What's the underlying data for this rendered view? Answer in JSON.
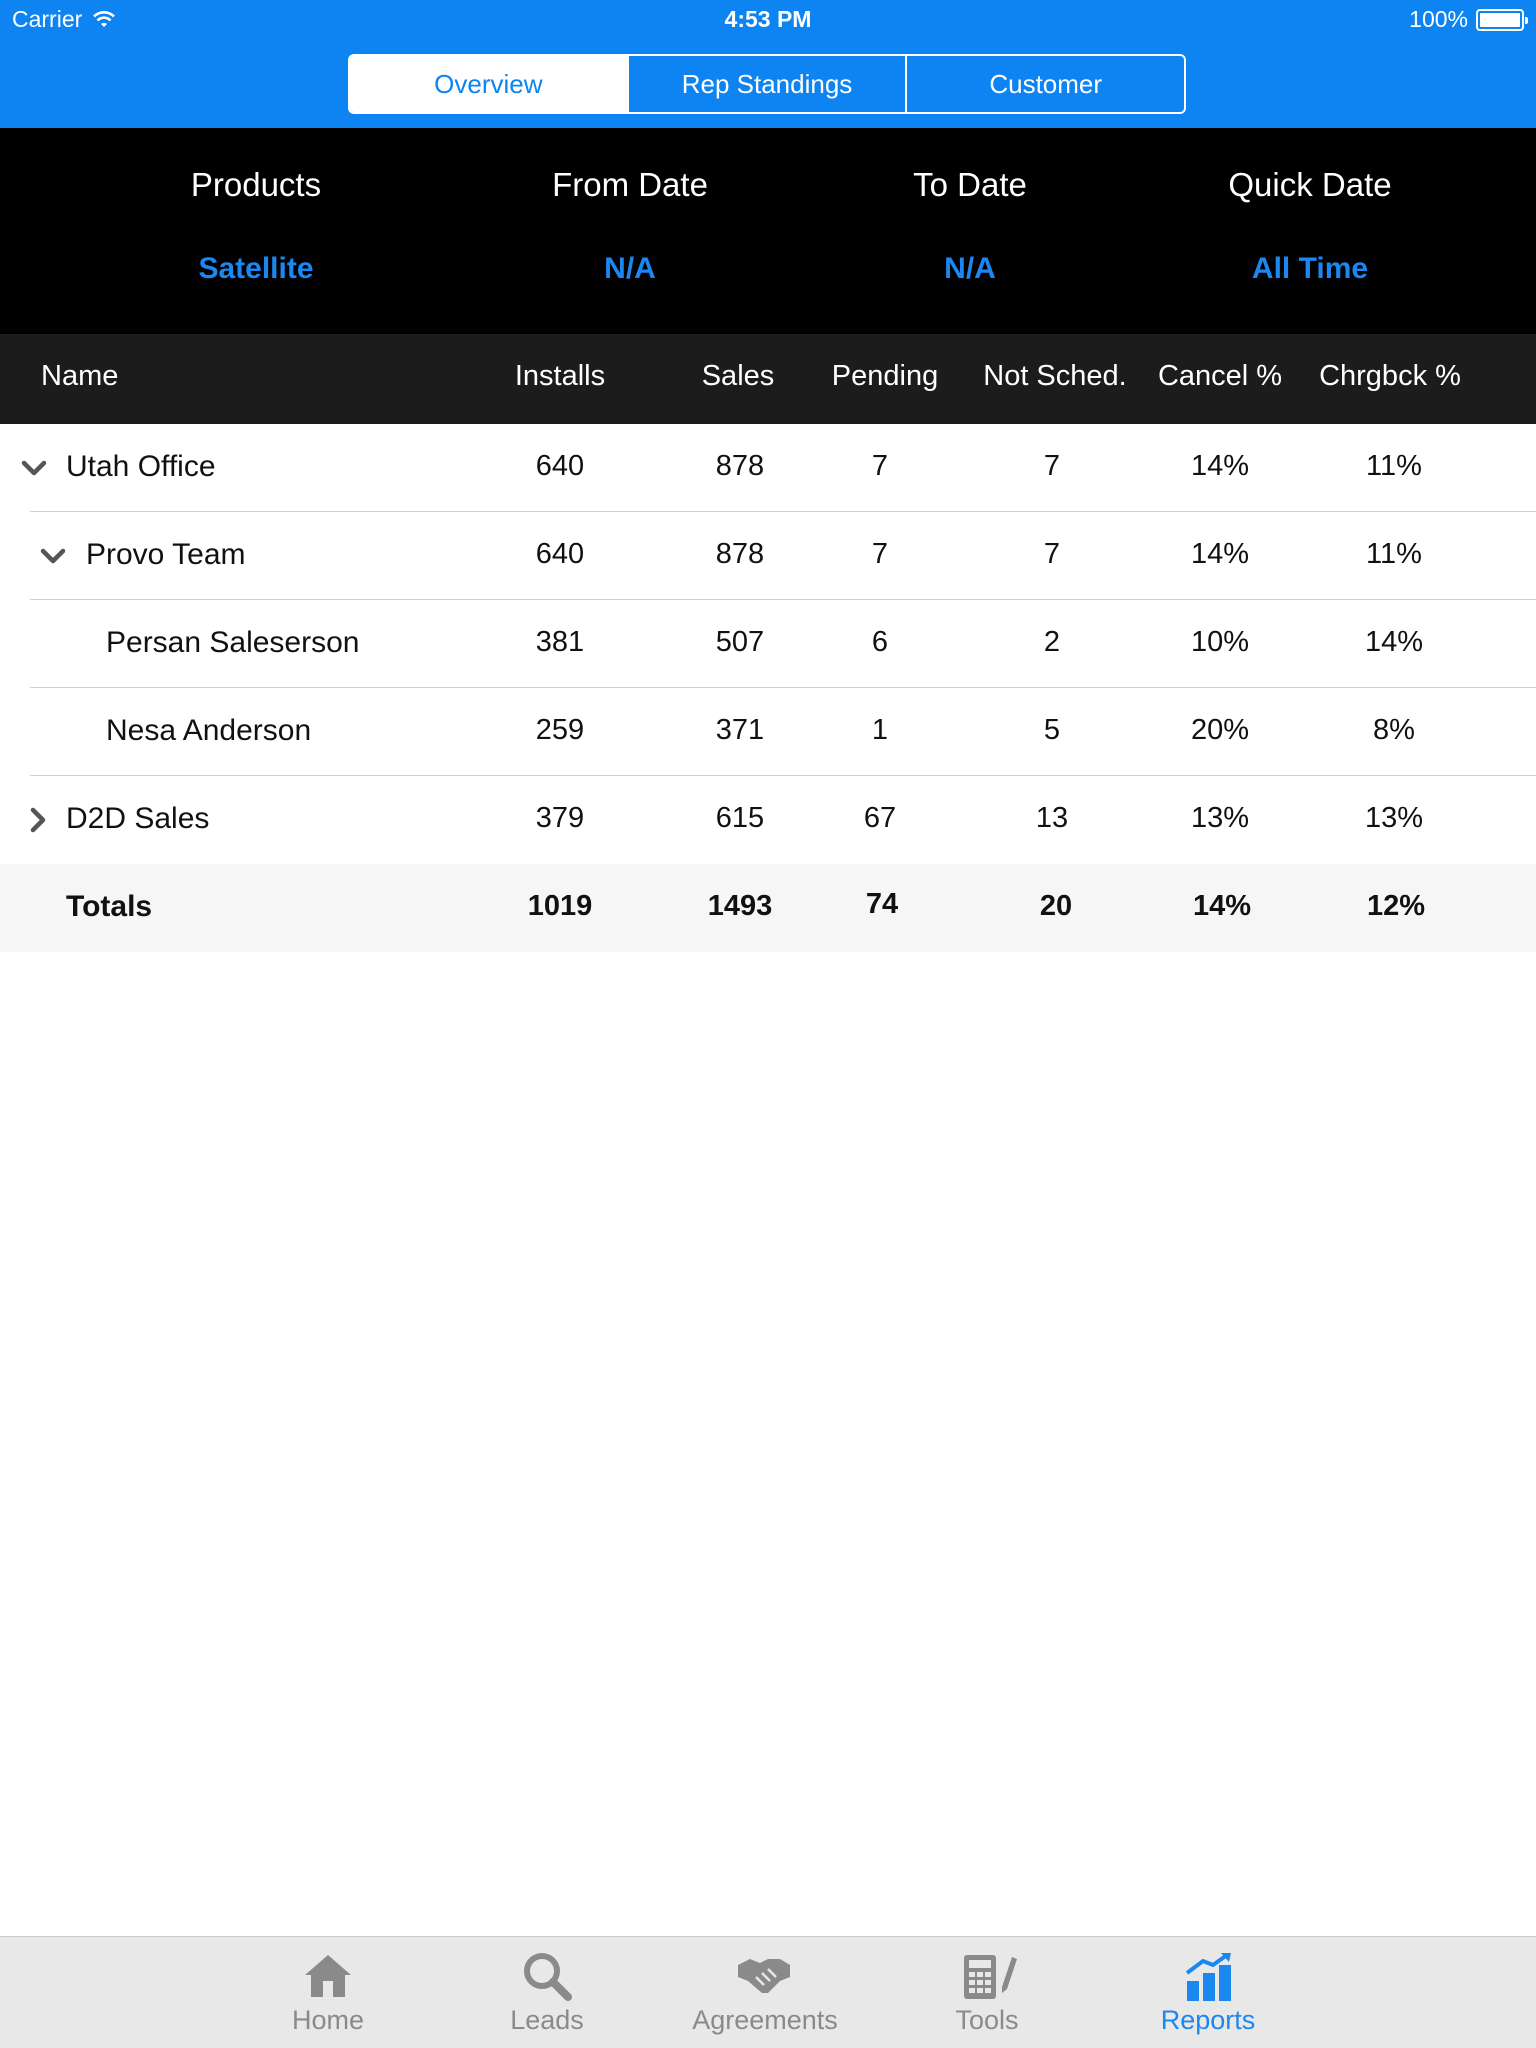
{
  "status": {
    "carrier": "Carrier",
    "time": "4:53 PM",
    "battery": "100%"
  },
  "segments": [
    {
      "label": "Overview",
      "active": true
    },
    {
      "label": "Rep Standings",
      "active": false
    },
    {
      "label": "Customer",
      "active": false
    }
  ],
  "filters": [
    {
      "label": "Products",
      "value": "Satellite"
    },
    {
      "label": "From Date",
      "value": "N/A"
    },
    {
      "label": "To Date",
      "value": "N/A"
    },
    {
      "label": "Quick Date",
      "value": "All Time"
    }
  ],
  "table": {
    "headers": {
      "name": "Name",
      "installs": "Installs",
      "sales": "Sales",
      "pending": "Pending",
      "not_sched": "Not Sched.",
      "cancel": "Cancel %",
      "chrgbck": "Chrgbck %"
    },
    "rows": [
      {
        "name": "Utah Office",
        "expander": "chevron-down",
        "installs": "640",
        "sales": "878",
        "pending": "7",
        "not_sched": "7",
        "cancel": "14%",
        "chrgbck": "11%"
      },
      {
        "name": "Provo Team",
        "expander": "chevron-down",
        "installs": "640",
        "sales": "878",
        "pending": "7",
        "not_sched": "7",
        "cancel": "14%",
        "chrgbck": "11%"
      },
      {
        "name": "Persan Saleserson",
        "expander": "",
        "installs": "381",
        "sales": "507",
        "pending": "6",
        "not_sched": "2",
        "cancel": "10%",
        "chrgbck": "14%"
      },
      {
        "name": "Nesa Anderson",
        "expander": "",
        "installs": "259",
        "sales": "371",
        "pending": "1",
        "not_sched": "5",
        "cancel": "20%",
        "chrgbck": "8%"
      },
      {
        "name": "D2D Sales",
        "expander": "chevron-right",
        "installs": "379",
        "sales": "615",
        "pending": "67",
        "not_sched": "13",
        "cancel": "13%",
        "chrgbck": "13%"
      }
    ],
    "totals": {
      "name": "Totals",
      "installs": "1019",
      "sales": "1493",
      "pending": "74",
      "not_sched": "20",
      "cancel": "14%",
      "chrgbck": "12%"
    }
  },
  "tabbar": [
    {
      "label": "Home",
      "icon": "house-icon",
      "active": false
    },
    {
      "label": "Leads",
      "icon": "magnifier-icon",
      "active": false
    },
    {
      "label": "Agreements",
      "icon": "handshake-icon",
      "active": false
    },
    {
      "label": "Tools",
      "icon": "calculator-icon",
      "active": false
    },
    {
      "label": "Reports",
      "icon": "bar-chart-icon",
      "active": true
    }
  ],
  "colors": {
    "brand_blue": "#0d84f2",
    "link_blue": "#1b87f0",
    "header_black": "#000000",
    "table_header": "#1c1c1c",
    "inactive_gray": "#8a8a8a"
  }
}
